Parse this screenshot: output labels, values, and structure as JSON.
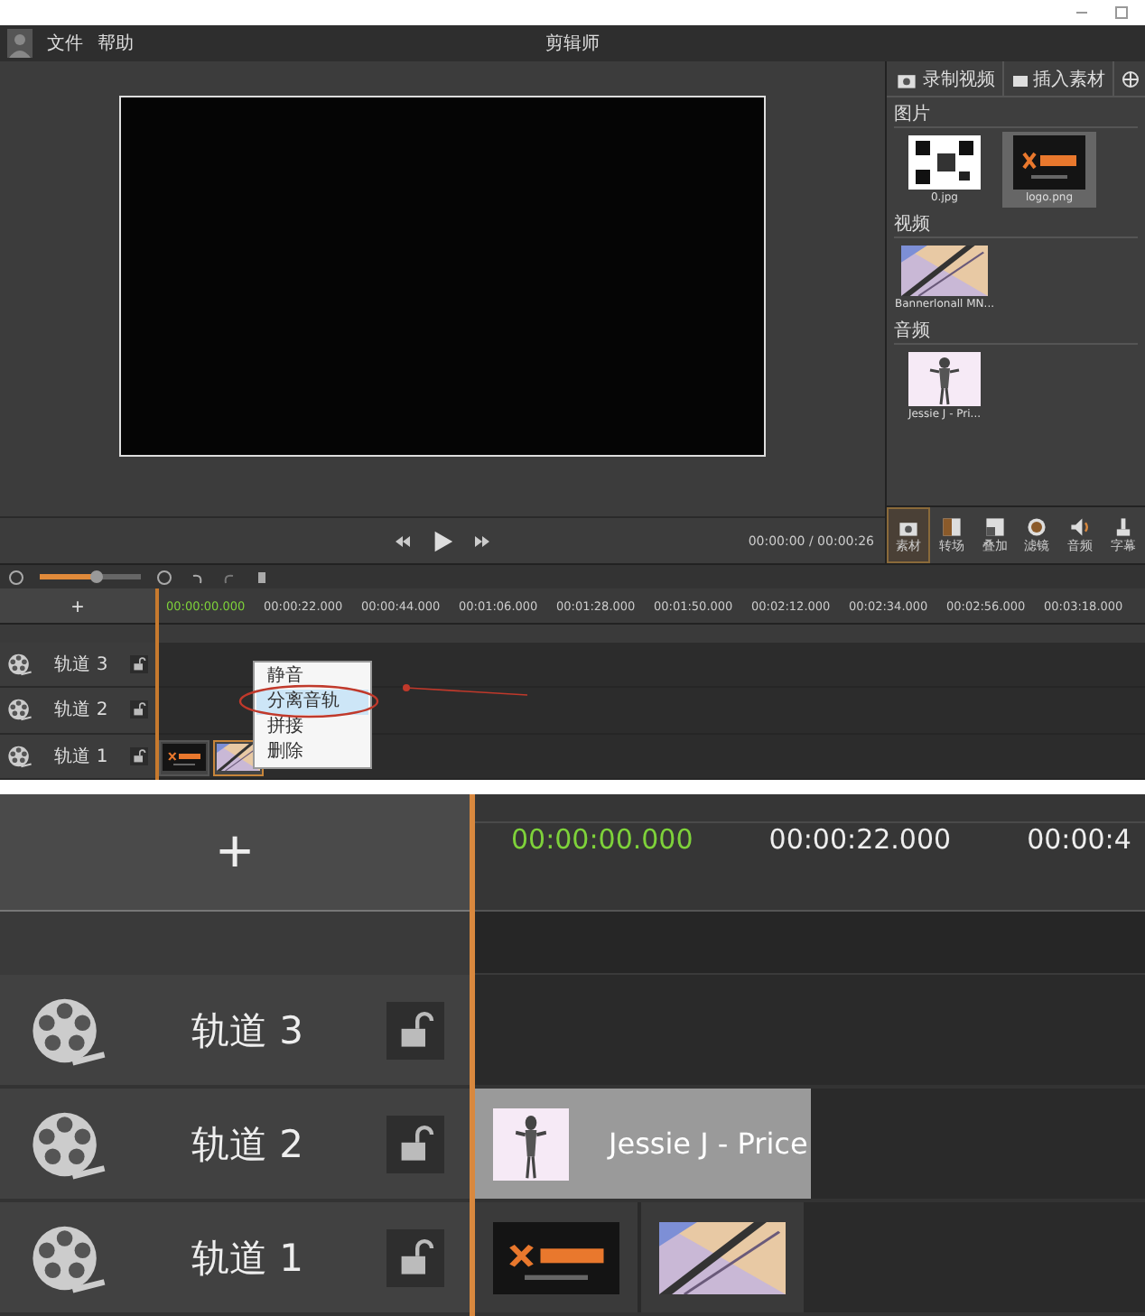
{
  "window": {
    "title": "剪辑师",
    "menu": [
      "文件",
      "帮助"
    ]
  },
  "media_tabs": [
    {
      "label": "录制视频",
      "kind": "camera"
    },
    {
      "label": "插入素材",
      "kind": "folder"
    },
    {
      "kind": "globe"
    }
  ],
  "library": [
    {
      "heading": "图片",
      "items": [
        {
          "name": "0.jpg",
          "kind": "qr",
          "selected": false
        },
        {
          "name": "logo.png",
          "kind": "logo",
          "selected": true
        }
      ]
    },
    {
      "heading": "视频",
      "items": [
        {
          "name": "Bannerlonall MN...",
          "kind": "gradient",
          "selected": false
        }
      ]
    },
    {
      "heading": "音频",
      "items": [
        {
          "name": "Jessie J - Pri...",
          "kind": "figure",
          "selected": false
        }
      ]
    }
  ],
  "player": {
    "time": "00:00:00 / 00:00:26"
  },
  "tools": [
    {
      "label": "素材",
      "kind": "camera",
      "selected": true
    },
    {
      "label": "转场",
      "kind": "split",
      "selected": false
    },
    {
      "label": "叠加",
      "kind": "overlay",
      "selected": false
    },
    {
      "label": "滤镜",
      "kind": "filter",
      "selected": false
    },
    {
      "label": "音频",
      "kind": "speaker",
      "selected": false
    },
    {
      "label": "字幕",
      "kind": "stamp",
      "selected": false
    }
  ],
  "timeline": {
    "add_label": "+",
    "zoom": {
      "level": 0.55
    },
    "current": "00:00:00.000",
    "ticks": [
      "00:00:22.000",
      "00:00:44.000",
      "00:01:06.000",
      "00:01:28.000",
      "00:01:50.000",
      "00:02:12.000",
      "00:02:34.000",
      "00:02:56.000",
      "00:03:18.000"
    ],
    "tracks": [
      {
        "name": "轨道 3"
      },
      {
        "name": "轨道 2"
      },
      {
        "name": "轨道 1",
        "clips": [
          {
            "kind": "logo"
          },
          {
            "kind": "gradient"
          }
        ]
      }
    ]
  },
  "context_menu": {
    "items": [
      {
        "label": "静音",
        "selected": false
      },
      {
        "label": "分离音轨",
        "selected": true
      },
      {
        "label": "拼接",
        "selected": false
      },
      {
        "label": "删除",
        "selected": false
      }
    ]
  },
  "zoom_view": {
    "add_label": "+",
    "current": "00:00:00.000",
    "ticks": [
      "00:00:22.000",
      "00:00:4"
    ],
    "tracks": [
      {
        "name": "轨道 3"
      },
      {
        "name": "轨道 2",
        "clips": [
          {
            "kind": "audio",
            "label": "Jessie J - Price"
          }
        ]
      },
      {
        "name": "轨道 1",
        "clips": [
          {
            "kind": "logo"
          },
          {
            "kind": "gradient"
          }
        ]
      }
    ]
  }
}
